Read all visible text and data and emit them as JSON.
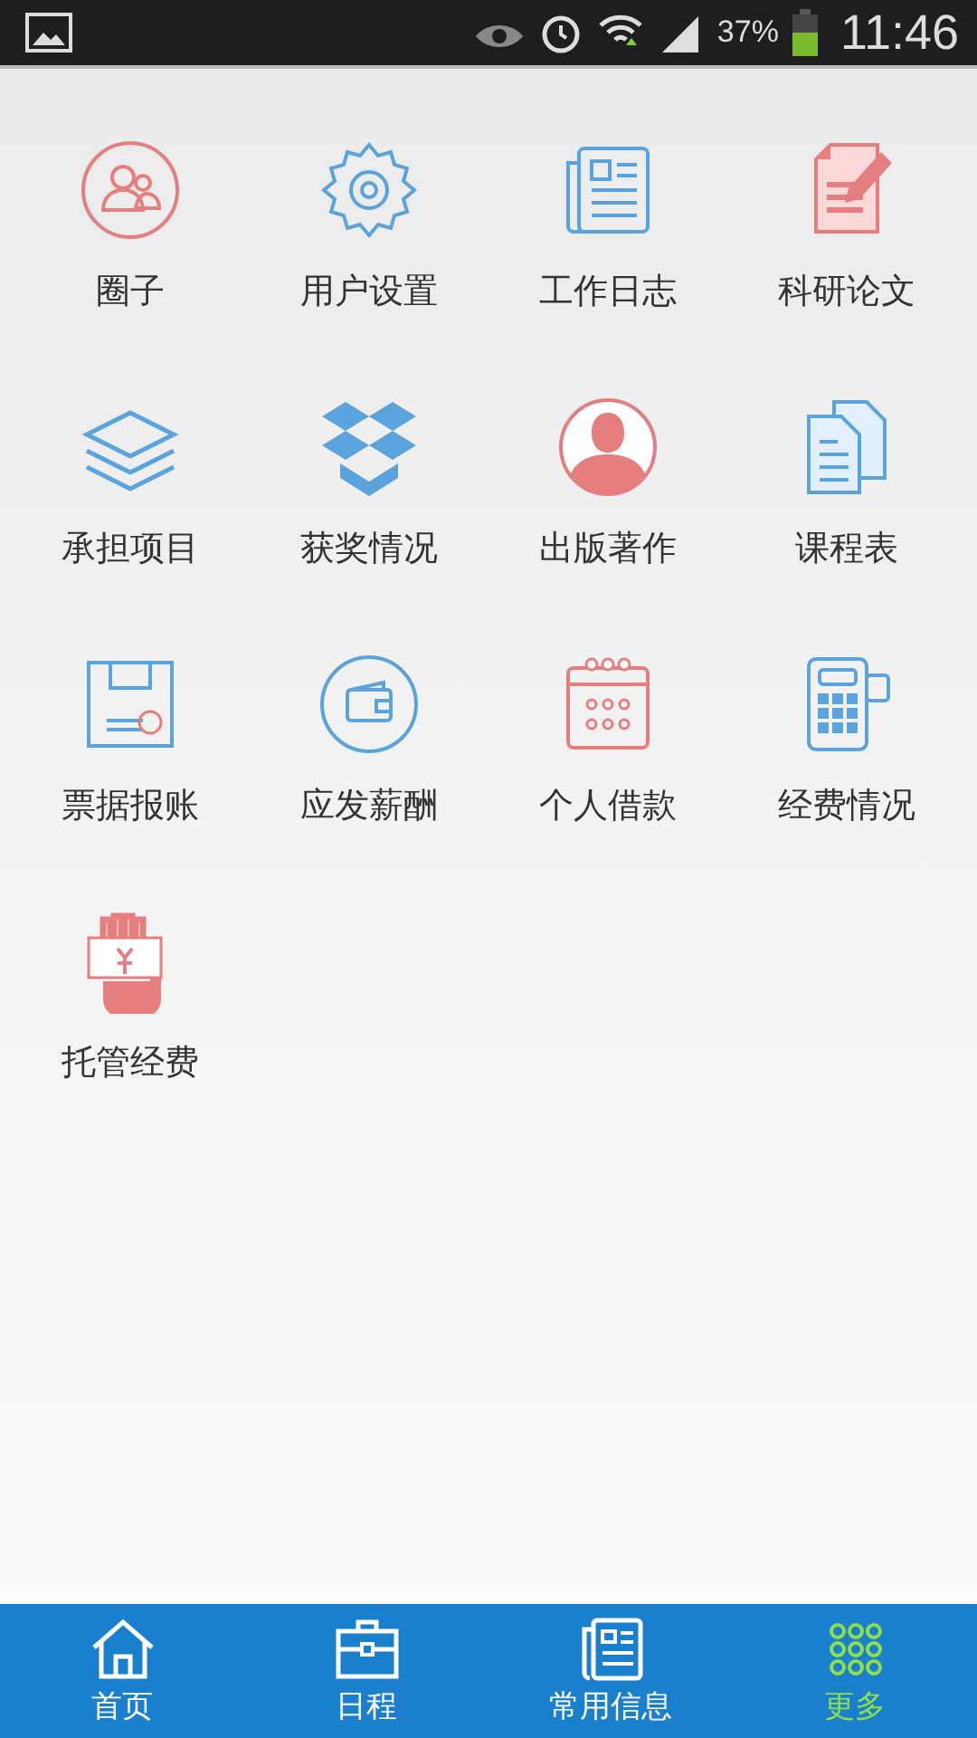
{
  "status_bar": {
    "battery": "37%",
    "time": "11:46"
  },
  "menu": [
    {
      "label": "圈子"
    },
    {
      "label": "用户设置"
    },
    {
      "label": "工作日志"
    },
    {
      "label": "科研论文"
    },
    {
      "label": "承担项目"
    },
    {
      "label": "获奖情况"
    },
    {
      "label": "出版著作"
    },
    {
      "label": "课程表"
    },
    {
      "label": "票据报账"
    },
    {
      "label": "应发薪酬"
    },
    {
      "label": "个人借款"
    },
    {
      "label": "经费情况"
    },
    {
      "label": "托管经费"
    }
  ],
  "bottom_nav": [
    {
      "label": "首页",
      "selected": false
    },
    {
      "label": "日程",
      "selected": false
    },
    {
      "label": "常用信息",
      "selected": false
    },
    {
      "label": "更多",
      "selected": true
    }
  ]
}
